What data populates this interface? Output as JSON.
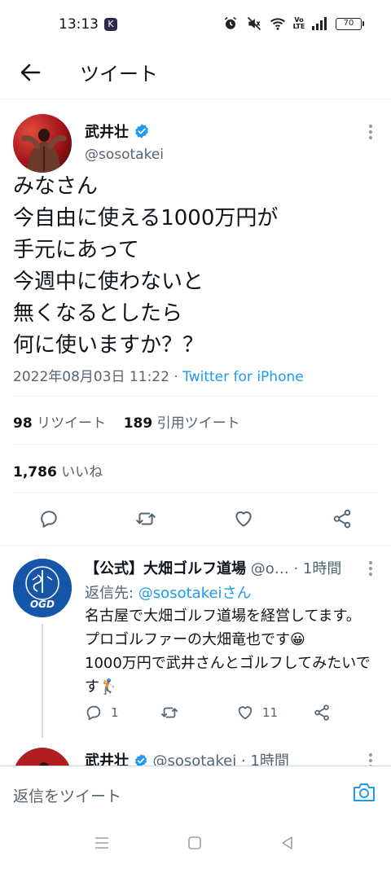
{
  "status_bar": {
    "time": "13:13",
    "app_icon": "K",
    "vo_label": "Vo\nLTE",
    "battery": "70",
    "icons": [
      "alarm-icon",
      "mute-icon",
      "wifi-icon",
      "volte-icon",
      "signal-icon",
      "battery-icon"
    ]
  },
  "header": {
    "title": "ツイート",
    "back_icon": "arrow-left-icon"
  },
  "tweet": {
    "author_name": "武井壮",
    "author_handle": "@sosotakei",
    "verified": true,
    "text": "みなさん\n今自由に使える1000万円が\n手元にあって\n今週中に使わないと\n無くなるとしたら\n何に使いますか？？",
    "timestamp": "2022年08月03日 11:22",
    "separator": " · ",
    "source": "Twitter for iPhone",
    "retweets_count": "98",
    "retweets_label": "リツイート",
    "quotes_count": "189",
    "quotes_label": "引用ツイート",
    "likes_count": "1,786",
    "likes_label": "いいね"
  },
  "reply": {
    "author_name": "【公式】大畑ゴルフ道場",
    "author_handle": "@o…",
    "time": "· 1時間",
    "reply_to_label": "返信先: ",
    "reply_to_user": "@sosotakeiさん",
    "text": "名古屋で大畑ゴルフ道場を経営してます。プロゴルファーの大畑竜也です😀\n1000万円で武井さんとゴルフしてみたいです🏌",
    "reply_count": "1",
    "retweet_count": "",
    "like_count": "11",
    "avatar_text": "OGD"
  },
  "reply2": {
    "author_name": "武井壮",
    "author_handle": "@sosotakei",
    "time": "· 1時間"
  },
  "composer": {
    "placeholder": "返信をツイート"
  },
  "colors": {
    "accent": "#1d9bf0",
    "secondary_text": "#536471",
    "primary_text": "#0f1419"
  }
}
